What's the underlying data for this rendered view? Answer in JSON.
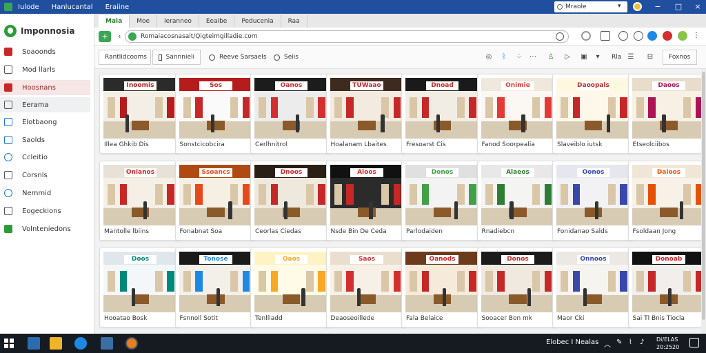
{
  "titlebar": {
    "menus": [
      "Iulode",
      "Hanlucantal",
      "Eraiine"
    ],
    "search_value": "Mraole",
    "controls": [
      "−",
      "□",
      "×"
    ]
  },
  "sidebar": {
    "brand": "Imponnosia",
    "items": [
      {
        "label": "Soaoonds",
        "icon": "bag-icon",
        "style": "red"
      },
      {
        "label": "Mod llarls",
        "icon": "home-icon",
        "style": ""
      },
      {
        "label": "Hoosnans",
        "icon": "store-icon",
        "style": "red"
      },
      {
        "label": "Eerama",
        "icon": "grid-icon",
        "style": ""
      },
      {
        "label": "Elotbaong",
        "icon": "chart-icon",
        "style": "blue"
      },
      {
        "label": "Saolds",
        "icon": "tag-icon",
        "style": "blue"
      },
      {
        "label": "Ccleitio",
        "icon": "globe-icon",
        "style": "blue"
      },
      {
        "label": "Corsnls",
        "icon": "box-icon",
        "style": ""
      },
      {
        "label": "Nemmid",
        "icon": "search-icon",
        "style": "blue"
      },
      {
        "label": "Eogeckions",
        "icon": "doc-icon",
        "style": ""
      },
      {
        "label": "Volnteniedons",
        "icon": "shield-icon",
        "style": "green"
      }
    ]
  },
  "tabs": [
    "Maia",
    "Moe",
    "Ieranneo",
    "Eeaibe",
    "Peducenia",
    "Raa"
  ],
  "address": {
    "url": "Romaiacosnasalt/Qigteimgilladie.com"
  },
  "toolbar": {
    "filter_label": "Rantlidcooms",
    "sort_label": "Sannnieli",
    "link1": "Reeve Sarsaels",
    "link2": "Seiis",
    "view_label": "Rla",
    "export_label": "Foxnos"
  },
  "cards": [
    {
      "sign": "Inoomis",
      "caption": "Illea Ghkib Dis",
      "wall": "#f4efe6",
      "accent": "#b71c1c",
      "ceiling": "#2b2b2b"
    },
    {
      "sign": "Sos",
      "caption": "Sonstcicobcira",
      "wall": "#fafafa",
      "accent": "#c62828",
      "ceiling": "#b71c1c"
    },
    {
      "sign": "Oanos",
      "caption": "Cerlhnitrol",
      "wall": "#ececec",
      "accent": "#d32f2f",
      "ceiling": "#1c1c1c"
    },
    {
      "sign": "TUWaao",
      "caption": "Hoalanam Lbaites",
      "wall": "#f3ebe0",
      "accent": "#c62828",
      "ceiling": "#3e2a1e"
    },
    {
      "sign": "Dnoad",
      "caption": "Fresoarst Cis",
      "wall": "#f2ede4",
      "accent": "#c62828",
      "ceiling": "#1a1a1a"
    },
    {
      "sign": "Onimie",
      "caption": "Fanod Soorpealia",
      "wall": "#fbf7f2",
      "accent": "#e53935",
      "ceiling": "#f0e8dc"
    },
    {
      "sign": "Daoopals",
      "caption": "Slaveiblo iutsk",
      "wall": "#fdf8ea",
      "accent": "#c62828",
      "ceiling": "#fff8e1"
    },
    {
      "sign": "Daoos",
      "caption": "Etseolciibos",
      "wall": "#f7f1e5",
      "accent": "#ad1457",
      "ceiling": "#e8dccb"
    },
    {
      "sign": "Onianos",
      "caption": "Mantolle lbiins",
      "wall": "#f5efe6",
      "accent": "#c62828",
      "ceiling": "#e7e1d8"
    },
    {
      "sign": "Ssoancs",
      "caption": "Fonabnat Soa",
      "wall": "#f6efe4",
      "accent": "#e64a19",
      "ceiling": "#b04a12"
    },
    {
      "sign": "Dnoos",
      "caption": "Ceorlas Ciedas",
      "wall": "#efe8dc",
      "accent": "#c62828",
      "ceiling": "#2a1f17"
    },
    {
      "sign": "Aloos",
      "caption": "Nsde Bin De Ceda",
      "wall": "#2b2b2b",
      "accent": "#c62828",
      "ceiling": "#111111"
    },
    {
      "sign": "Donos",
      "caption": "Parlodaiden",
      "wall": "#f3f3f3",
      "accent": "#43a047",
      "ceiling": "#e0e0e0"
    },
    {
      "sign": "Alaeos",
      "caption": "Rnadiebcn",
      "wall": "#f4f4f2",
      "accent": "#2e7d32",
      "ceiling": "#e8e8e8"
    },
    {
      "sign": "Oonos",
      "caption": "Fonidanao Salds",
      "wall": "#f2f2f5",
      "accent": "#3949ab",
      "ceiling": "#e6e6ee"
    },
    {
      "sign": "Daioos",
      "caption": "Fsoldaan Jong",
      "wall": "#f7f1e8",
      "accent": "#e65100",
      "ceiling": "#efe6d8"
    },
    {
      "sign": "Doos",
      "caption": "Hooatao Bosk",
      "wall": "#f4f7f9",
      "accent": "#00897b",
      "ceiling": "#dfe7ec"
    },
    {
      "sign": "Tonose",
      "caption": "Fsnnoll Sotit",
      "wall": "#f3f0ea",
      "accent": "#1e88e5",
      "ceiling": "#1a1a1a"
    },
    {
      "sign": "Oaos",
      "caption": "Tenllladd",
      "wall": "#fffbe6",
      "accent": "#f9a825",
      "ceiling": "#fff3c4"
    },
    {
      "sign": "Saos",
      "caption": "Deaoseoillede",
      "wall": "#f7f0e6",
      "accent": "#d32f2f",
      "ceiling": "#eadfcf"
    },
    {
      "sign": "Oanods",
      "caption": "Fala Belaice",
      "wall": "#f6eadb",
      "accent": "#c62828",
      "ceiling": "#6d3b1c"
    },
    {
      "sign": "Donos",
      "caption": "Sooacer Bon mk",
      "wall": "#efe9df",
      "accent": "#c62828",
      "ceiling": "#1b1b1b"
    },
    {
      "sign": "Onnoos",
      "caption": "Maor Cki",
      "wall": "#f6f4f1",
      "accent": "#3949ab",
      "ceiling": "#ece8e3"
    },
    {
      "sign": "Donoab",
      "caption": "Sai Tl Bnis Tiocla",
      "wall": "#f1efec",
      "accent": "#c62828",
      "ceiling": "#111111"
    }
  ],
  "taskbar": {
    "tray_text": "Elobec I Nealas",
    "clock_time": "Di/ELAS",
    "clock_date": "20:2520"
  }
}
